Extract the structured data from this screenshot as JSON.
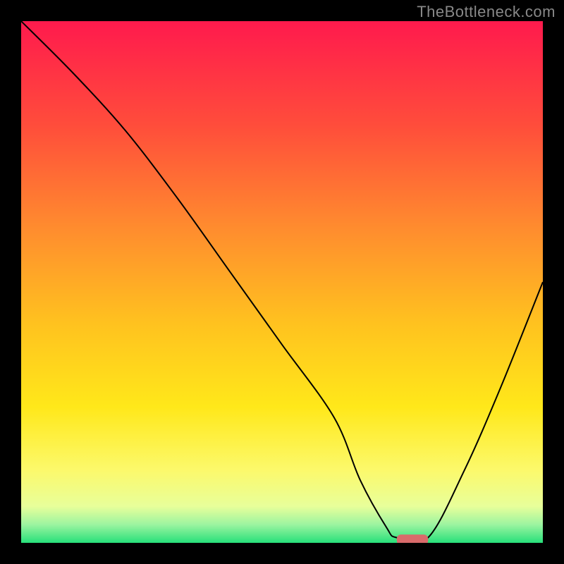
{
  "watermark": "TheBottleneck.com",
  "chart_data": {
    "type": "line",
    "title": "",
    "xlabel": "",
    "ylabel": "",
    "xlim": [
      0,
      100
    ],
    "ylim": [
      0,
      100
    ],
    "grid": false,
    "legend": false,
    "background": {
      "type": "vertical-gradient",
      "description": "Vertical gradient: red at top through orange, yellow, pale yellow to green at the bottom edge",
      "stops": [
        {
          "offset": 0.0,
          "color": "#ff1a4d"
        },
        {
          "offset": 0.2,
          "color": "#ff4d3b"
        },
        {
          "offset": 0.4,
          "color": "#ff8d2e"
        },
        {
          "offset": 0.58,
          "color": "#ffc21f"
        },
        {
          "offset": 0.74,
          "color": "#ffe81a"
        },
        {
          "offset": 0.86,
          "color": "#fcf96b"
        },
        {
          "offset": 0.93,
          "color": "#e8ff9a"
        },
        {
          "offset": 0.965,
          "color": "#9cf4a0"
        },
        {
          "offset": 1.0,
          "color": "#27e07a"
        }
      ]
    },
    "series": [
      {
        "name": "bottleneck-curve",
        "type": "line",
        "color": "#000000",
        "stroke_width": 2,
        "x": [
          0,
          10,
          20,
          30,
          40,
          50,
          60,
          65,
          70,
          72,
          78,
          85,
          92,
          100
        ],
        "y": [
          100,
          90,
          79,
          66,
          52,
          38,
          24,
          12,
          3,
          1,
          1,
          14,
          30,
          50
        ]
      }
    ],
    "marker": {
      "name": "balance-point",
      "shape": "rounded-bar",
      "color": "#d96b6b",
      "x_range": [
        72,
        78
      ],
      "y": 0.6,
      "height": 2.0
    }
  }
}
